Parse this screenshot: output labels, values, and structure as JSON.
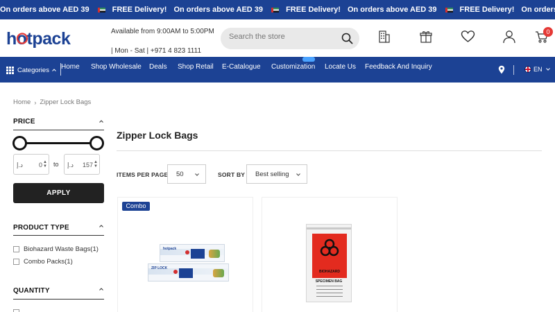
{
  "marquee": {
    "offer_text": "On orders above AED 39",
    "delivery_text": "FREE Delivery!"
  },
  "header": {
    "logo_text": "hotpack",
    "hours": "Available from 9:00AM to 5:00PM",
    "contact": "| Mon - Sat | +971 4 823 1111",
    "search_placeholder": "Search the store",
    "cart_count": "0"
  },
  "nav": {
    "categories_label": "Categories",
    "items": [
      "Home",
      "Shop Wholesale",
      "Deals",
      "Shop Retail",
      "E-Catalogue",
      "Customization",
      "Locate Us",
      "Feedback And Inquiry"
    ],
    "language": "EN"
  },
  "breadcrumb": {
    "home": "Home",
    "current": "Zipper Lock Bags"
  },
  "sidebar": {
    "price_title": "PRICE",
    "price_min_currency": "د.إ",
    "price_min": "0",
    "price_max_currency": "د.إ",
    "price_max": "157",
    "to_label": "to",
    "apply_label": "APPLY",
    "product_type_title": "PRODUCT TYPE",
    "product_types": [
      {
        "label": "Biohazard Waste Bags",
        "count": "(1)"
      },
      {
        "label": "Combo Packs",
        "count": "(1)"
      }
    ],
    "quantity_title": "QUANTITY",
    "toggle_symbol": "^"
  },
  "main": {
    "title": "Zipper Lock Bags",
    "items_per_page_label": "ITEMS PER PAGE",
    "items_per_page_value": "50",
    "sort_by_label": "SORT BY",
    "sort_by_value": "Best selling"
  },
  "products": [
    {
      "badge": "Combo",
      "pack_brand": "hotpack",
      "pack_label": "ZIP LOCK"
    },
    {
      "bag_top_text": "BIOHAZARD",
      "bag_title": "SPECIMEN BAG"
    }
  ],
  "colors": {
    "brand_blue": "#1c4294",
    "accent_red": "#e53935",
    "dark": "#222222"
  }
}
